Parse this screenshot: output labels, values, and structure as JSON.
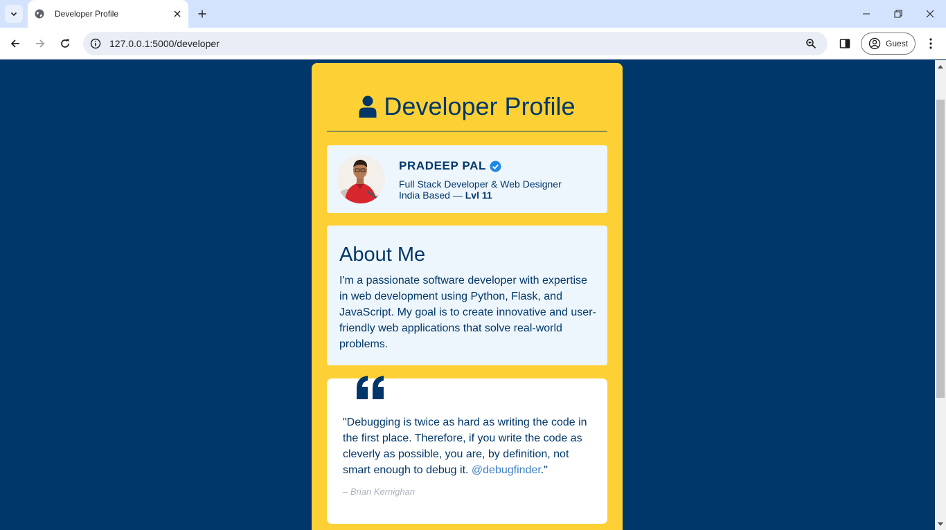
{
  "browser": {
    "tab_title": "Developer Profile",
    "url": "127.0.0.1:5000/developer",
    "profile_label": "Guest"
  },
  "page": {
    "heading": "Developer Profile",
    "profile": {
      "name": "PRADEEP PAL",
      "role": "Full Stack Developer & Web Designer",
      "location": "India Based —",
      "level": "Lvl 11"
    },
    "about": {
      "title": "About Me",
      "text": "I'm a passionate software developer with expertise in web development using Python, Flask, and JavaScript. My goal is to create innovative and user-friendly web applications that solve real-world problems."
    },
    "quote": {
      "text": "\"Debugging is twice as hard as writing the code in the first place. Therefore, if you write the code as cleverly as possible, you are, by definition, not smart enough to debug it.",
      "handle": "@debugfinder",
      "closing": ".\"",
      "author": "– Brian Kernighan"
    }
  },
  "colors": {
    "page_background": "#00376a",
    "card_background": "#fdd135",
    "panel_background": "#eef6fd",
    "text_primary": "#00376a",
    "link": "#3d7fc7",
    "verified_badge": "#1e88e5"
  },
  "icons": {
    "tab_favicon": "globe-icon",
    "heading": "user-icon",
    "verified": "verified-check-icon",
    "quote": "quote-left-icon"
  }
}
